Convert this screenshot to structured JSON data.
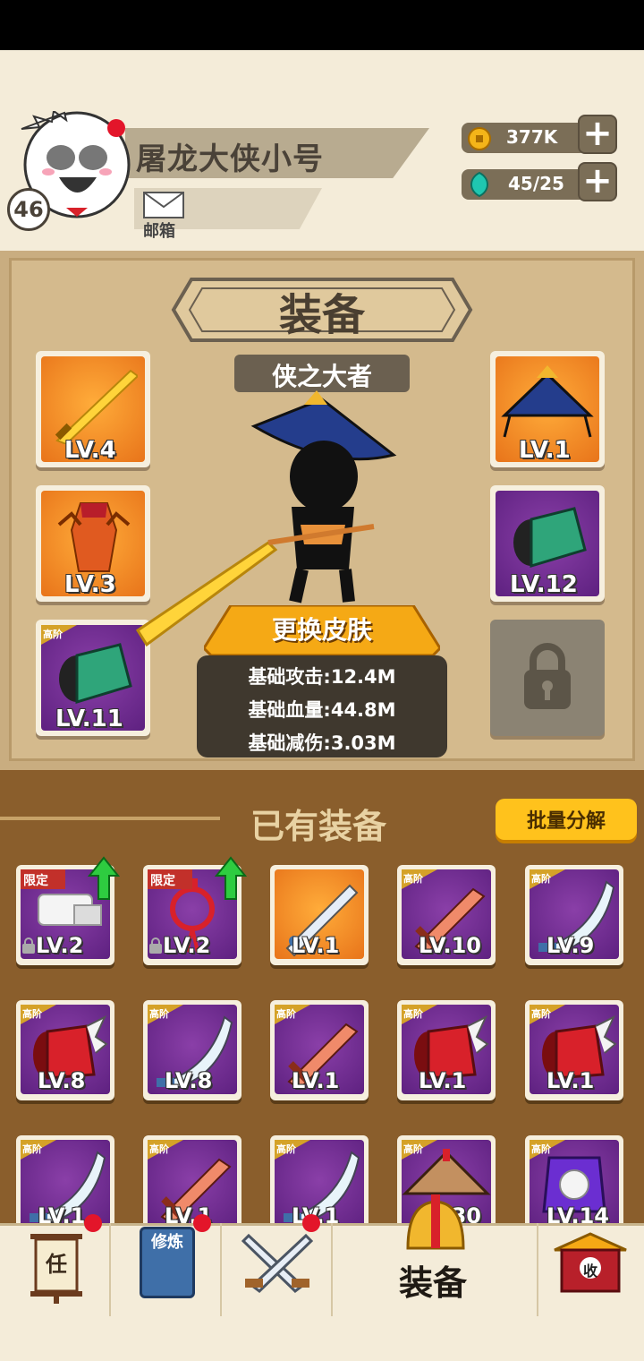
{
  "player": {
    "name": "屠龙大侠小号",
    "level": "46"
  },
  "header": {
    "mail_label": "邮箱"
  },
  "resources": [
    {
      "icon": "coin-icon",
      "value": "377K"
    },
    {
      "icon": "gem-icon",
      "value": "45/25"
    }
  ],
  "equipment": {
    "title": "装备",
    "subtitle": "侠之大者",
    "skin_button": "更换皮肤",
    "stats": [
      "基础攻击:12.4M",
      "基础血量:44.8M",
      "基础减伤:3.03M"
    ],
    "slots_left": [
      {
        "name": "sword-slot",
        "level": "LV.4",
        "bg": "orange",
        "icon": "golden-sword-icon"
      },
      {
        "name": "armor-slot",
        "level": "LV.3",
        "bg": "orange",
        "icon": "armor-icon"
      },
      {
        "name": "bracer-slot",
        "level": "LV.11",
        "bg": "purple",
        "tier": "高阶",
        "icon": "bracer-icon"
      }
    ],
    "slots_right": [
      {
        "name": "hat-slot",
        "level": "LV.1",
        "bg": "orange",
        "icon": "straw-hat-icon"
      },
      {
        "name": "gauntlet-slot",
        "level": "LV.12",
        "bg": "purple",
        "icon": "bracer-icon"
      }
    ]
  },
  "owned": {
    "title": "已有装备",
    "bulk_button": "批量分解",
    "items": [
      {
        "level": "LV.2",
        "tag": "限定",
        "locked": true,
        "upgrade": true,
        "bg": "purple",
        "icon": "scroll-icon"
      },
      {
        "level": "LV.2",
        "tag": "限定",
        "locked": true,
        "upgrade": true,
        "bg": "purple",
        "icon": "red-knot-icon"
      },
      {
        "level": "LV.1",
        "bg": "orange",
        "icon": "sword-icon"
      },
      {
        "level": "LV.10",
        "tier": "高阶",
        "bg": "purple",
        "icon": "wooden-sword-icon"
      },
      {
        "level": "LV.9",
        "tier": "高阶",
        "bg": "purple",
        "icon": "saber-icon"
      },
      {
        "level": "LV.8",
        "tier": "高阶",
        "bg": "purple",
        "icon": "red-bracer-icon"
      },
      {
        "level": "LV.8",
        "tier": "高阶",
        "bg": "purple",
        "icon": "saber-icon"
      },
      {
        "level": "LV.1",
        "tier": "高阶",
        "bg": "purple",
        "icon": "wooden-sword-icon"
      },
      {
        "level": "LV.1",
        "tier": "高阶",
        "bg": "purple",
        "icon": "red-bracer-icon"
      },
      {
        "level": "LV.1",
        "tier": "高阶",
        "bg": "purple",
        "icon": "red-bracer-icon"
      },
      {
        "level": "LV.1",
        "tier": "高阶",
        "bg": "purple",
        "icon": "saber-icon"
      },
      {
        "level": "LV.1",
        "tier": "高阶",
        "bg": "purple",
        "icon": "wooden-sword-icon"
      },
      {
        "level": "LV.1",
        "tier": "高阶",
        "bg": "purple",
        "icon": "saber-icon"
      },
      {
        "level": "LV.30",
        "tier": "高阶",
        "bg": "purple",
        "icon": "straw-hat-icon"
      },
      {
        "level": "LV.14",
        "tier": "高阶",
        "bg": "purple",
        "icon": "orb-armor-icon"
      }
    ]
  },
  "nav": {
    "task_glyph": "任",
    "cultivate_glyph": "修炼",
    "active_label": "装备",
    "collect_glyph": "收"
  }
}
